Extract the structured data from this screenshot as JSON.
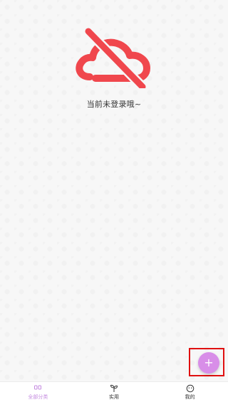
{
  "empty_state": {
    "message": "当前未登录哦~",
    "icon": "cloud-off-icon",
    "icon_color": "#f0474d"
  },
  "fab": {
    "label": "+",
    "icon": "plus-icon",
    "color": "#d88ee8",
    "highlight_color": "#e01010"
  },
  "tabbar": {
    "accent_color": "#c58be0",
    "tabs": [
      {
        "label": "全部分类",
        "icon": "grid-icon",
        "active": true
      },
      {
        "label": "实用",
        "icon": "sprout-icon",
        "active": false
      },
      {
        "label": "我的",
        "icon": "smiley-icon",
        "active": false
      }
    ]
  }
}
